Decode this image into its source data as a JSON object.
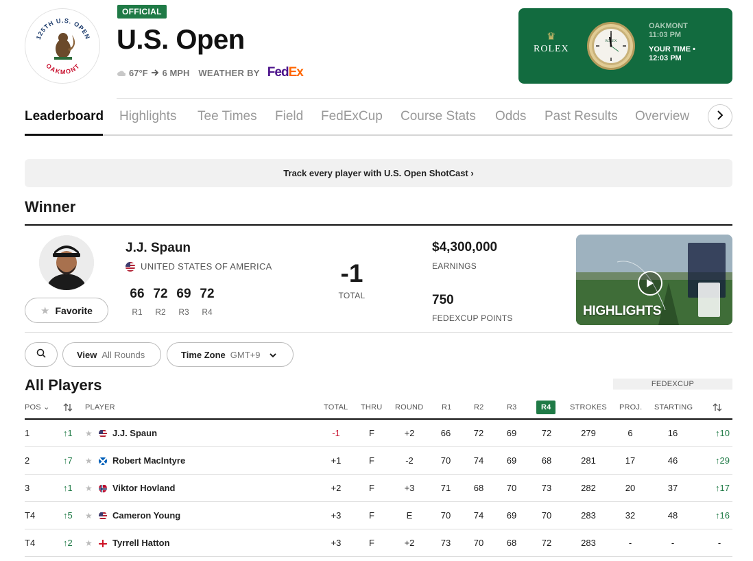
{
  "header": {
    "badge": "OFFICIAL",
    "title": "U.S. Open",
    "weather": {
      "temp": "67°F",
      "wind": "6 MPH",
      "label": "WEATHER BY",
      "sponsor_a": "Fed",
      "sponsor_b": "Ex"
    },
    "logo": {
      "top_text": "125TH U.S. OPEN",
      "bottom_text": "OAKMONT"
    },
    "rolex": {
      "brand": "ROLEX",
      "location": "OAKMONT",
      "location_time": "11:03 PM",
      "your_label": "YOUR TIME •",
      "your_time": "12:03 PM",
      "dial_text": "ROLEX",
      "bg_color": "#126b3f"
    }
  },
  "tabs": [
    "Leaderboard",
    "Highlights",
    "Tee Times",
    "Field",
    "FedExCup",
    "Course Stats",
    "Odds",
    "Past Results",
    "Overview"
  ],
  "shotcast": "Track every player with U.S. Open ShotCast ›",
  "winner": {
    "heading": "Winner",
    "name": "J.J. Spaun",
    "country": "UNITED STATES OF AMERICA",
    "favorite_label": "Favorite",
    "rounds": [
      {
        "score": "66",
        "label": "R1"
      },
      {
        "score": "72",
        "label": "R2"
      },
      {
        "score": "69",
        "label": "R3"
      },
      {
        "score": "72",
        "label": "R4"
      }
    ],
    "total": "-1",
    "total_label": "TOTAL",
    "earnings": "$4,300,000",
    "earnings_label": "EARNINGS",
    "fedex_points": "750",
    "fedex_label": "FEDEXCUP POINTS",
    "highlights_label": "HIGHLIGHTS"
  },
  "filters": {
    "view_label": "View",
    "view_value": "All Rounds",
    "tz_label": "Time Zone",
    "tz_value": "GMT+9"
  },
  "all_players": {
    "heading": "All Players",
    "fedex_tag": "FEDEXCUP",
    "columns": {
      "pos": "POS",
      "player": "PLAYER",
      "total": "TOTAL",
      "thru": "THRU",
      "round": "ROUND",
      "r1": "R1",
      "r2": "R2",
      "r3": "R3",
      "r4": "R4",
      "strokes": "STROKES",
      "proj": "PROJ.",
      "starting": "STARTING"
    },
    "rows": [
      {
        "pos": "1",
        "move": "1",
        "name": "J.J. Spaun",
        "country": "us",
        "total": "-1",
        "thru": "F",
        "round": "+2",
        "r1": "66",
        "r2": "72",
        "r3": "69",
        "r4": "72",
        "strokes": "279",
        "proj": "6",
        "starting": "16",
        "fedex_move": "10"
      },
      {
        "pos": "2",
        "move": "7",
        "name": "Robert MacIntyre",
        "country": "sco",
        "total": "+1",
        "thru": "F",
        "round": "-2",
        "r1": "70",
        "r2": "74",
        "r3": "69",
        "r4": "68",
        "strokes": "281",
        "proj": "17",
        "starting": "46",
        "fedex_move": "29"
      },
      {
        "pos": "3",
        "move": "1",
        "name": "Viktor Hovland",
        "country": "nor",
        "total": "+2",
        "thru": "F",
        "round": "+3",
        "r1": "71",
        "r2": "68",
        "r3": "70",
        "r4": "73",
        "strokes": "282",
        "proj": "20",
        "starting": "37",
        "fedex_move": "17"
      },
      {
        "pos": "T4",
        "move": "5",
        "name": "Cameron Young",
        "country": "us",
        "total": "+3",
        "thru": "F",
        "round": "E",
        "r1": "70",
        "r2": "74",
        "r3": "69",
        "r4": "70",
        "strokes": "283",
        "proj": "32",
        "starting": "48",
        "fedex_move": "16"
      },
      {
        "pos": "T4",
        "move": "2",
        "name": "Tyrrell Hatton",
        "country": "eng",
        "total": "+3",
        "thru": "F",
        "round": "+2",
        "r1": "73",
        "r2": "70",
        "r3": "68",
        "r4": "72",
        "strokes": "283",
        "proj": "-",
        "starting": "-",
        "fedex_move": "-"
      }
    ]
  },
  "colors": {
    "accent_green": "#1f7a46",
    "negative_red": "#c8102e",
    "fedex_purple": "#4d148c",
    "fedex_orange": "#ff6600"
  }
}
